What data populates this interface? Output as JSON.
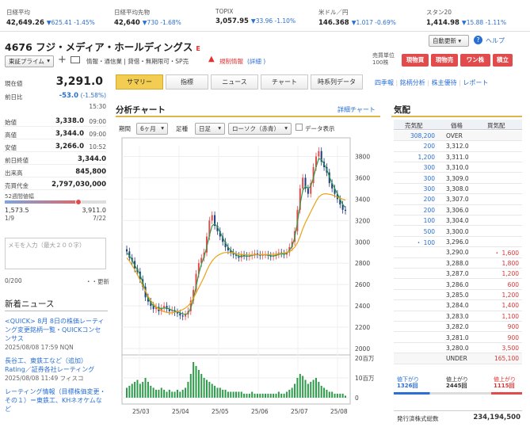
{
  "indices": [
    {
      "name": "日経平均",
      "value": "42,649.26",
      "change": "▼625.41 -1.45%"
    },
    {
      "name": "日経平均先物",
      "value": "42,640",
      "change": "▼730 -1.68%"
    },
    {
      "name": "TOPIX",
      "value": "3,057.95",
      "change": "▼33.96 -1.10%"
    },
    {
      "name": "米ドル／円",
      "value": "146.368",
      "change": "▼1.017 -0.69%"
    },
    {
      "name": "スタン20",
      "value": "1,414.98",
      "change": "▼15.88 -1.11%"
    }
  ],
  "stock": {
    "title": "4676 フジ・メディア・ホールディングス",
    "badge": "E",
    "market": "東証プライム",
    "info_links": "情報・通信業 | 貸借・無期限可・SP売",
    "alert_text": "規制情報",
    "alert_detail": "(詳細 )",
    "unit_label": "売買単位",
    "unit_value": "100株"
  },
  "top_right": {
    "auto_update": "自動更新",
    "help": "ヘルプ",
    "buy_cash": "現物買",
    "sell_cash": "現物売",
    "one_click": "ワン株",
    "accum": "積立"
  },
  "tabs": [
    "サマリー",
    "指標",
    "ニュース",
    "チャート",
    "時系列データ"
  ],
  "tab_links": [
    "四季報",
    "銘柄分析",
    "株主優待",
    "レポート"
  ],
  "price": {
    "current_label": "現在値",
    "current": "3,291.0",
    "change_label": "前日比",
    "change": "-53.0",
    "change_pct": "(-1.58%)",
    "time": "15:30",
    "rows": [
      {
        "k": "始値",
        "v": "3,338.0",
        "t": "09:00"
      },
      {
        "k": "高値",
        "v": "3,344.0",
        "t": "09:00"
      },
      {
        "k": "安値",
        "v": "3,266.0",
        "t": "10:52"
      }
    ],
    "rows2": [
      {
        "k": "前日終値",
        "v": "3,344.0"
      },
      {
        "k": "出来高",
        "v": "845,800"
      },
      {
        "k": "売買代金",
        "v": "2,797,030,000"
      }
    ],
    "range_label": "52週間値幅",
    "low": "1,573.5",
    "low_date": "1/9",
    "high": "3,911.0",
    "high_date": "7/22",
    "range_fill": 0.73
  },
  "memo": {
    "placeholder": "メモを入力（最大２００字）",
    "count": "0/200",
    "update": "更新"
  },
  "news": {
    "heading": "新着ニュース",
    "items": [
      {
        "text": "<QUICK> 8月 8日の株価レーティング変更銘柄一覧・QUICKコンセンサス",
        "meta": "2025/08/08 17:59 NQN"
      },
      {
        "text": "長谷工、東鉄工など（追加）Rating／証券各社レーティング",
        "meta": "2025/08/08 11:49 フィスコ"
      },
      {
        "text": "レーティング情報（目標株価変更・その１）＝東鉄工、KHネオケムなど",
        "meta": ""
      }
    ]
  },
  "chart": {
    "heading": "分析チャート",
    "detail_link": "詳細チャート",
    "period_label": "期間",
    "period": "6ヶ月",
    "foot_label": "足種",
    "foot": "日足",
    "candle": "ローソク（赤青）",
    "data_show": "データ表示"
  },
  "chart_data": {
    "type": "candlestick",
    "xlabels": [
      "25/03",
      "25/04",
      "25/05",
      "25/06",
      "25/07",
      "25/08"
    ],
    "price_ticks": [
      "3800",
      "3600",
      "3400",
      "3200",
      "3000",
      "2800",
      "2600",
      "2400",
      "2200",
      "2000"
    ],
    "volume_ticks": [
      "20百万",
      "10百万",
      "0"
    ],
    "ylim": [
      2000,
      3900
    ],
    "close": [
      2910,
      2850,
      2820,
      2750,
      2720,
      2650,
      2580,
      2480,
      2440,
      2400,
      2370,
      2390,
      2350,
      2380,
      2400,
      2370,
      2350,
      2360,
      2340,
      2330,
      2310,
      2300,
      2320,
      2350,
      2450,
      2550,
      2700,
      2800,
      2850,
      2900,
      3050,
      3200,
      3250,
      3150,
      3100,
      3050,
      3000,
      2950,
      2920,
      2900,
      2880,
      2870,
      2850,
      2880,
      2870,
      2860,
      2870,
      2880,
      2890,
      2880,
      2870,
      2880,
      2880,
      2870,
      2860,
      2870,
      2880,
      2900,
      2890,
      2880,
      2900,
      2950,
      3000,
      3100,
      3300,
      3500,
      3600,
      3500,
      3450,
      3550,
      3700,
      3800,
      3850,
      3750,
      3700,
      3650,
      3550,
      3500,
      3450,
      3400,
      3350,
      3300,
      3291
    ],
    "ma_short": [
      2900,
      2870,
      2830,
      2780,
      2740,
      2690,
      2620,
      2540,
      2470,
      2430,
      2400,
      2390,
      2380,
      2375,
      2380,
      2380,
      2370,
      2360,
      2350,
      2345,
      2335,
      2325,
      2320,
      2330,
      2380,
      2460,
      2580,
      2700,
      2790,
      2860,
      2950,
      3060,
      3150,
      3170,
      3140,
      3090,
      3040,
      2990,
      2950,
      2920,
      2900,
      2880,
      2865,
      2865,
      2868,
      2866,
      2867,
      2872,
      2878,
      2880,
      2878,
      2878,
      2879,
      2876,
      2870,
      2868,
      2872,
      2882,
      2888,
      2886,
      2892,
      2920,
      2960,
      3040,
      3180,
      3350,
      3480,
      3520,
      3500,
      3520,
      3600,
      3700,
      3780,
      3770,
      3730,
      3680,
      3610,
      3550,
      3500,
      3450,
      3400,
      3350,
      3320
    ],
    "ma_long": [
      2850,
      2820,
      2780,
      2740,
      2690,
      2640,
      2590,
      2540,
      2490,
      2450,
      2420,
      2390,
      2370,
      2355,
      2345,
      2340,
      2335,
      2335,
      2340,
      2345,
      2355,
      2365,
      2380,
      2400,
      2430,
      2470,
      2520,
      2570,
      2620,
      2670,
      2730,
      2780,
      2820,
      2850,
      2870,
      2885,
      2895,
      2900,
      2900,
      2898,
      2895,
      2890,
      2885,
      2882,
      2880,
      2878,
      2877,
      2877,
      2878,
      2879,
      2880,
      2880,
      2880,
      2881,
      2882,
      2883,
      2885,
      2888,
      2892,
      2896,
      2900,
      2910,
      2925,
      2950,
      2990,
      3050,
      3120,
      3180,
      3230,
      3280,
      3330,
      3380,
      3420,
      3440,
      3450,
      3450,
      3445,
      3440,
      3430,
      3420,
      3410,
      3400,
      3390
    ],
    "volume": [
      5,
      6,
      7,
      8,
      9,
      7,
      8,
      10,
      8,
      6,
      5,
      4,
      4,
      5,
      4,
      3,
      4,
      3,
      3,
      4,
      3,
      4,
      5,
      8,
      12,
      18,
      16,
      14,
      12,
      10,
      9,
      8,
      7,
      6,
      5,
      5,
      4,
      4,
      3,
      3,
      3,
      3,
      3,
      3,
      2,
      2,
      2,
      3,
      2,
      2,
      2,
      2,
      2,
      2,
      2,
      2,
      2,
      3,
      2,
      2,
      3,
      4,
      5,
      7,
      10,
      12,
      11,
      9,
      7,
      8,
      9,
      10,
      8,
      6,
      5,
      4,
      3,
      3,
      2,
      2,
      2,
      2,
      1
    ]
  },
  "board": {
    "heading": "気配",
    "col_sell": "売気配",
    "col_price": "価格",
    "col_buy": "買気配",
    "rows": [
      {
        "sell": "308,200",
        "price": "OVER",
        "buy": ""
      },
      {
        "sell": "200",
        "price": "3,312.0",
        "buy": ""
      },
      {
        "sell": "1,200",
        "price": "3,311.0",
        "buy": ""
      },
      {
        "sell": "300",
        "price": "3,310.0",
        "buy": ""
      },
      {
        "sell": "300",
        "price": "3,309.0",
        "buy": ""
      },
      {
        "sell": "300",
        "price": "3,308.0",
        "buy": ""
      },
      {
        "sell": "200",
        "price": "3,307.0",
        "buy": ""
      },
      {
        "sell": "200",
        "price": "3,306.0",
        "buy": ""
      },
      {
        "sell": "100",
        "price": "3,304.0",
        "buy": ""
      },
      {
        "sell": "500",
        "price": "3,300.0",
        "buy": ""
      },
      {
        "sell": "・ 100",
        "price": "3,296.0",
        "buy": ""
      },
      {
        "sell": "",
        "price": "3,290.0",
        "buy": "・ 1,600"
      },
      {
        "sell": "",
        "price": "3,288.0",
        "buy": "1,800"
      },
      {
        "sell": "",
        "price": "3,287.0",
        "buy": "1,200"
      },
      {
        "sell": "",
        "price": "3,286.0",
        "buy": "600"
      },
      {
        "sell": "",
        "price": "3,285.0",
        "buy": "1,200"
      },
      {
        "sell": "",
        "price": "3,284.0",
        "buy": "1,400"
      },
      {
        "sell": "",
        "price": "3,283.0",
        "buy": "1,100"
      },
      {
        "sell": "",
        "price": "3,282.0",
        "buy": "900"
      },
      {
        "sell": "",
        "price": "3,281.0",
        "buy": "900"
      },
      {
        "sell": "",
        "price": "3,280.0",
        "buy": "3,500"
      },
      {
        "sell": "",
        "price": "UNDER",
        "buy": "165,100"
      }
    ],
    "down_label": "値下がり",
    "down_count": "1326回",
    "mid_label": "値上がり",
    "mid_count": "2445回",
    "up_label": "値上がり",
    "up_count": "1115回",
    "shares_label": "発行済株式総数",
    "shares_value": "234,194,500"
  }
}
